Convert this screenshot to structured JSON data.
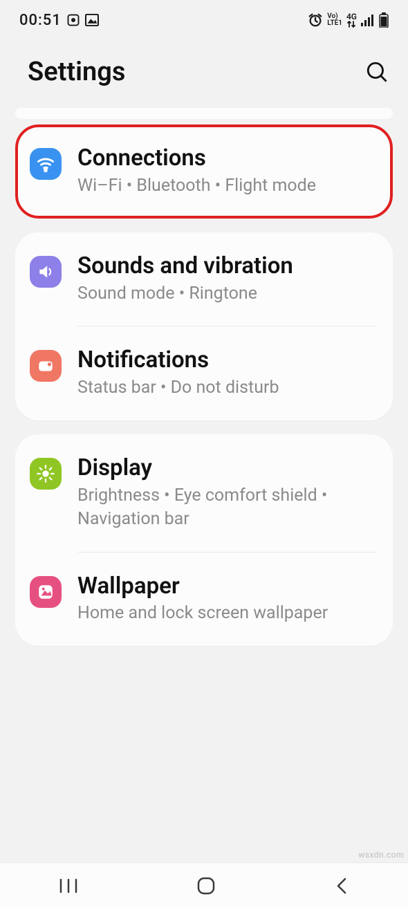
{
  "status": {
    "time": "00:51",
    "lte_top": "Vo)",
    "lte_bot": "LTE1",
    "net": "4G"
  },
  "header": {
    "title": "Settings"
  },
  "groups": [
    {
      "highlighted": true,
      "rows": [
        {
          "icon": "wifi",
          "color": "#3a92f0",
          "title": "Connections",
          "sub": "Wi–Fi  •  Bluetooth  •  Flight mode"
        }
      ]
    },
    {
      "rows": [
        {
          "icon": "sound",
          "color": "#8d80e8",
          "title": "Sounds and vibration",
          "sub": "Sound mode  •  Ringtone"
        },
        {
          "icon": "notif",
          "color": "#f07764",
          "title": "Notifications",
          "sub": "Status bar  •  Do not disturb"
        }
      ]
    },
    {
      "rows": [
        {
          "icon": "display",
          "color": "#90c624",
          "title": "Display",
          "sub": "Brightness  •  Eye comfort shield  •  Navigation bar"
        },
        {
          "icon": "wallpaper",
          "color": "#e65081",
          "title": "Wallpaper",
          "sub": "Home and lock screen wallpaper"
        }
      ]
    }
  ],
  "watermark": "wsxdn.com"
}
